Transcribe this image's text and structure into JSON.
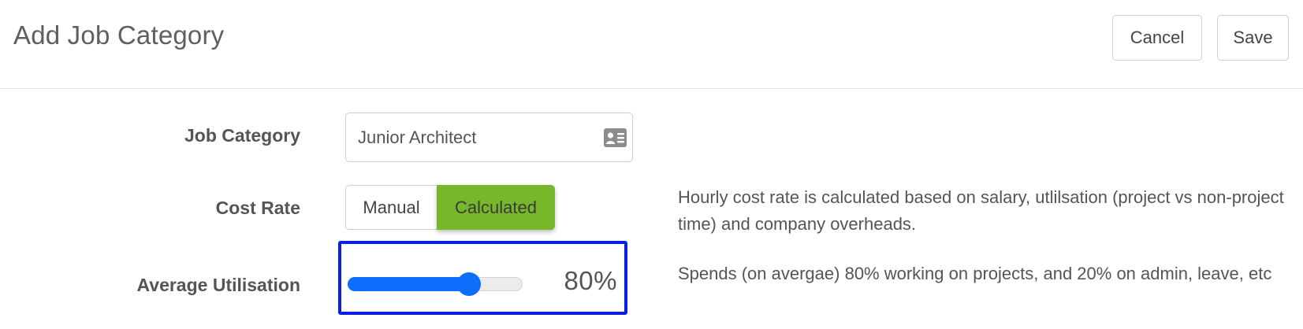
{
  "header": {
    "title": "Add Job Category",
    "cancel_label": "Cancel",
    "save_label": "Save"
  },
  "form": {
    "job_category": {
      "label": "Job Category",
      "value": "Junior Architect",
      "icon": "id-card-icon"
    },
    "cost_rate": {
      "label": "Cost Rate",
      "options": [
        "Manual",
        "Calculated"
      ],
      "selected": "Calculated",
      "help": "Hourly cost rate is calculated based on salary, utlilsation (project vs non-project time) and company overheads."
    },
    "average_utilisation": {
      "label": "Average Utilisation",
      "value_percent": 80,
      "display": "80%",
      "help": "Spends (on avergae) 80% working on projects, and 20% on admin, leave, etc"
    }
  },
  "colors": {
    "selected_toggle": "#76b82a",
    "slider_accent": "#0f6dfb",
    "focus_outline": "#0a1fe6"
  }
}
